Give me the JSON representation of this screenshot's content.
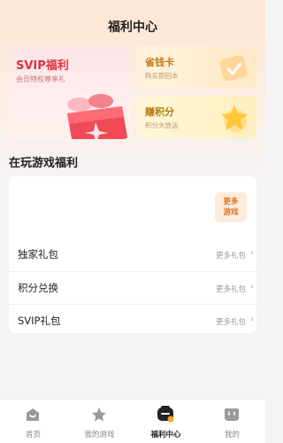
{
  "header": {
    "title": "福利中心"
  },
  "cards": {
    "svip": {
      "title": "SVIP福利",
      "subtitle": "会员特权尊享礼"
    },
    "save": {
      "title": "省钱卡",
      "subtitle": "购买即回本"
    },
    "points": {
      "title": "赚积分",
      "subtitle": "积分大放送"
    }
  },
  "section": {
    "title": "在玩游戏福利"
  },
  "more_games": {
    "line1": "更多",
    "line2": "游戏"
  },
  "rows": [
    {
      "label": "独家礼包",
      "more": "更多礼包",
      "chevron": "›"
    },
    {
      "label": "积分兑换",
      "more": "更多礼包",
      "chevron": "›"
    },
    {
      "label": "SVIP礼包",
      "more": "更多礼包",
      "chevron": "›"
    }
  ],
  "tabs": [
    {
      "label": "首页",
      "icon": "home-icon"
    },
    {
      "label": "我的游戏",
      "icon": "star-icon"
    },
    {
      "label": "福利中心",
      "icon": "welfare-icon",
      "active": true
    },
    {
      "label": "我的",
      "icon": "profile-icon"
    }
  ],
  "colors": {
    "accent_red": "#e0323f",
    "accent_orange": "#e0761b",
    "active_tab": "#222222"
  }
}
